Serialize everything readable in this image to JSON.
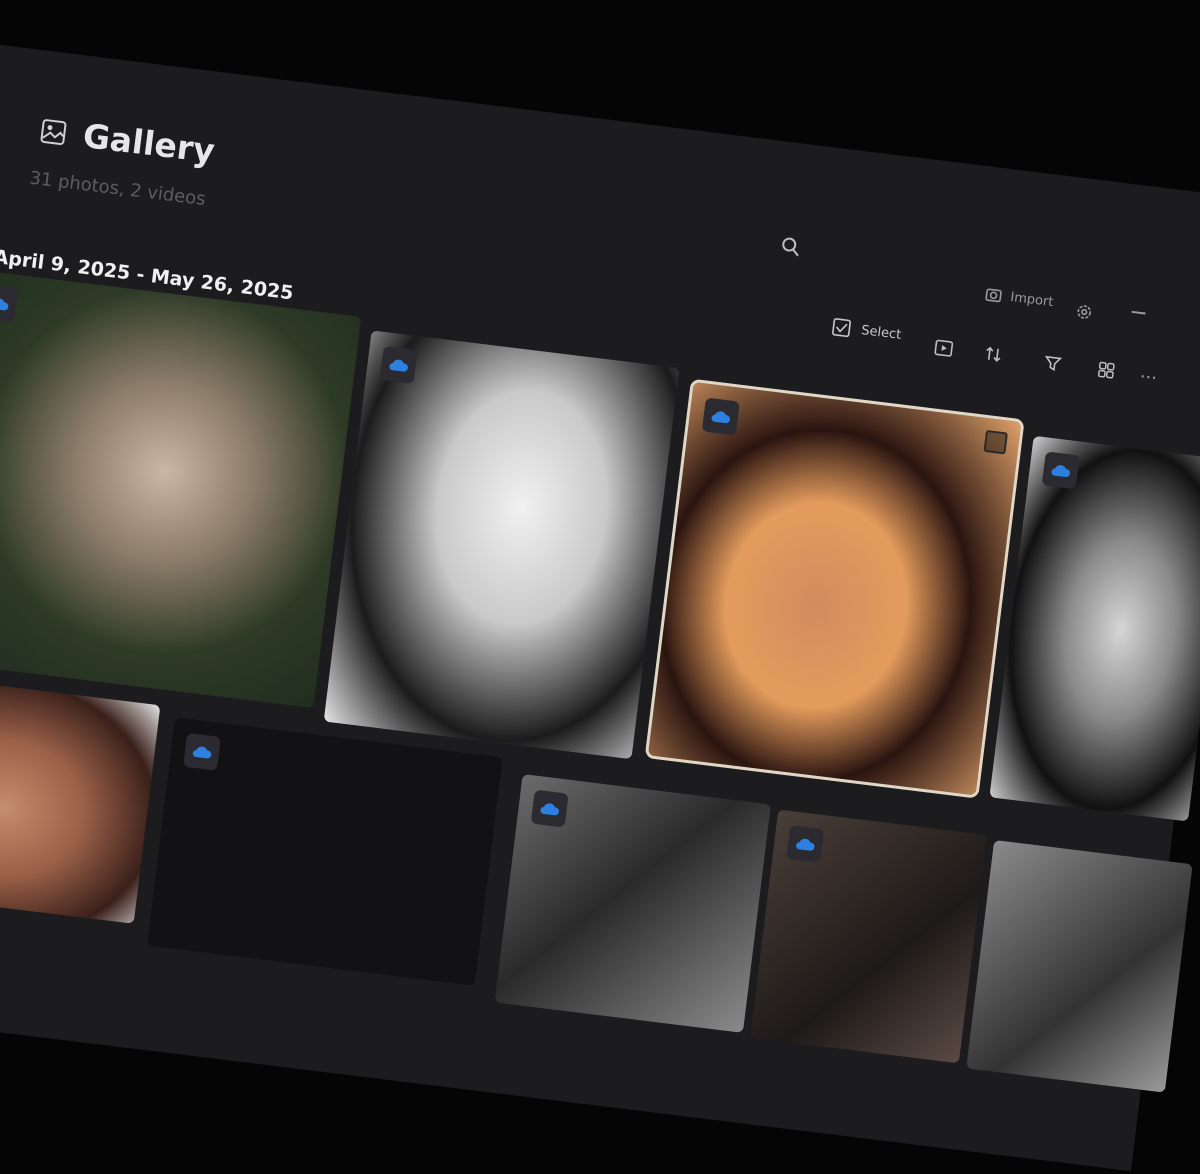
{
  "header": {
    "title": "Gallery",
    "subtitle": "31 photos, 2 videos",
    "date_range": "April 9, 2025 - May 26, 2025"
  },
  "toolbar": {
    "import_label": "Import",
    "select_label": "Select"
  },
  "icons": {
    "title": "gallery-icon",
    "search": "search-icon",
    "import": "import-icon",
    "settings": "gear-icon",
    "select": "select-checkbox-icon",
    "slideshow": "slideshow-icon",
    "sort": "sort-icon",
    "filter": "filter-icon",
    "layout": "layout-icon",
    "more": "more-icon",
    "cloud": "cloud-icon"
  },
  "colors": {
    "background": "#1c1c1f",
    "accent_cloud": "#2d7fe0",
    "selected_outline": "#e2d7c6"
  },
  "photos": [
    {
      "id": "photo-1",
      "selected": false,
      "cloud": true
    },
    {
      "id": "photo-2",
      "selected": false,
      "cloud": true
    },
    {
      "id": "photo-3",
      "selected": true,
      "cloud": true
    },
    {
      "id": "photo-4",
      "selected": false,
      "cloud": true
    },
    {
      "id": "photo-5",
      "selected": false,
      "cloud": false
    },
    {
      "id": "photo-6",
      "selected": false,
      "cloud": true
    },
    {
      "id": "photo-7",
      "selected": false,
      "cloud": true
    },
    {
      "id": "photo-8",
      "selected": false,
      "cloud": true
    },
    {
      "id": "photo-9",
      "selected": false,
      "cloud": false
    }
  ]
}
